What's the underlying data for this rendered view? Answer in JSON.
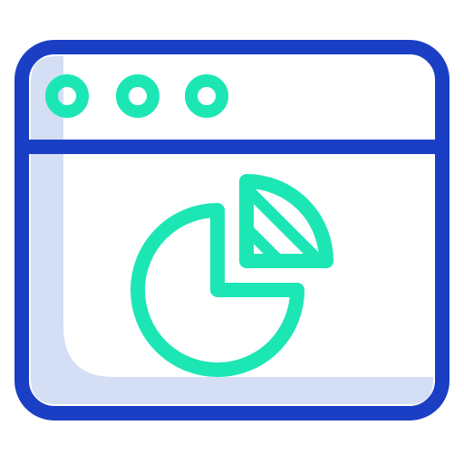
{
  "icon": {
    "name": "browser-window-pie-chart-icon",
    "colors": {
      "outline": "#1a3fc4",
      "accent": "#1de6b5",
      "shadow": "#d4def4",
      "background": "#ffffff"
    }
  },
  "window": {
    "title_bar_buttons": [
      "dot-1",
      "dot-2",
      "dot-3"
    ]
  },
  "pie_chart": {
    "slices_shown": 2,
    "detached_slice_fraction": 0.25,
    "detached_slice_pattern": "diagonal-stripes"
  }
}
